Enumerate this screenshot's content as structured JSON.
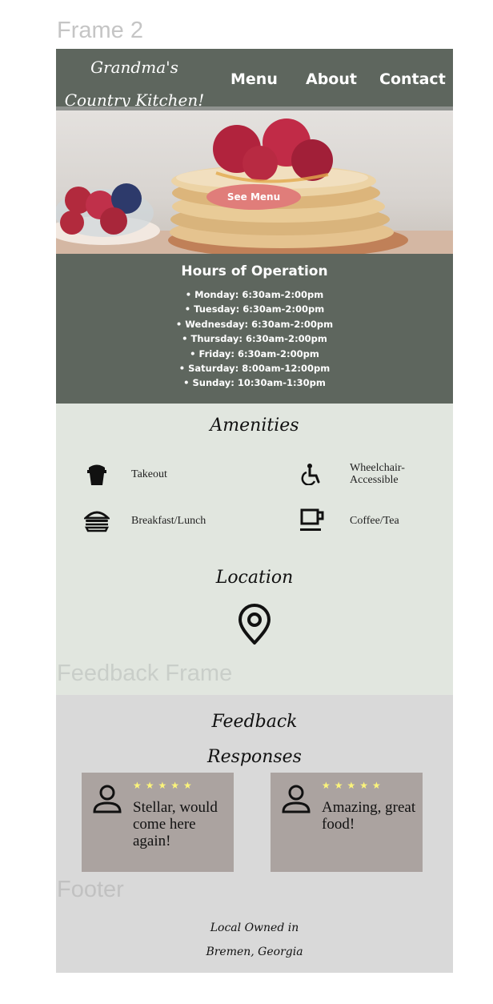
{
  "canvas_labels": {
    "frame": "Frame 2",
    "feedback_frame": "Feedback Frame",
    "footer": "Footer"
  },
  "header": {
    "brand": "Grandma's Country Kitchen!",
    "nav": [
      "Menu",
      "About",
      "Contact"
    ]
  },
  "hero": {
    "cta_label": "See Menu"
  },
  "hours": {
    "title": "Hours of Operation",
    "items": [
      "Monday: 6:30am-2:00pm",
      "Tuesday: 6:30am-2:00pm",
      "Wednesday: 6:30am-2:00pm",
      "Thursday: 6:30am-2:00pm",
      "Friday: 6:30am-2:00pm",
      "Saturday: 8:00am-12:00pm",
      "Sunday: 10:30am-1:30pm"
    ]
  },
  "amenities": {
    "title": "Amenities",
    "items": [
      {
        "label": "Takeout",
        "icon": "takeout-icon"
      },
      {
        "label": "Wheelchair-Accessible",
        "icon": "wheelchair-icon"
      },
      {
        "label": "Breakfast/Lunch",
        "icon": "burger-icon"
      },
      {
        "label": "Coffee/Tea",
        "icon": "coffee-mug-icon"
      }
    ]
  },
  "location": {
    "title": "Location",
    "icon": "map-pin-icon"
  },
  "feedback": {
    "title": "Feedback Responses",
    "reviews": [
      {
        "stars": "★★★★★",
        "rating": 5,
        "quote": "Stellar, would come here again!"
      },
      {
        "stars": "★★★★★",
        "rating": 5,
        "quote": "Amazing, great food!"
      }
    ]
  },
  "footer": {
    "text": "Local Owned in Bremen, Georgia"
  },
  "colors": {
    "header_bg": "#5e665e",
    "amenities_bg": "#e1e6df",
    "feedback_bg": "#d9d9d9",
    "card_bg": "#aba3a0",
    "cta_bg": "#e07d7a",
    "star": "#fbf47a"
  }
}
